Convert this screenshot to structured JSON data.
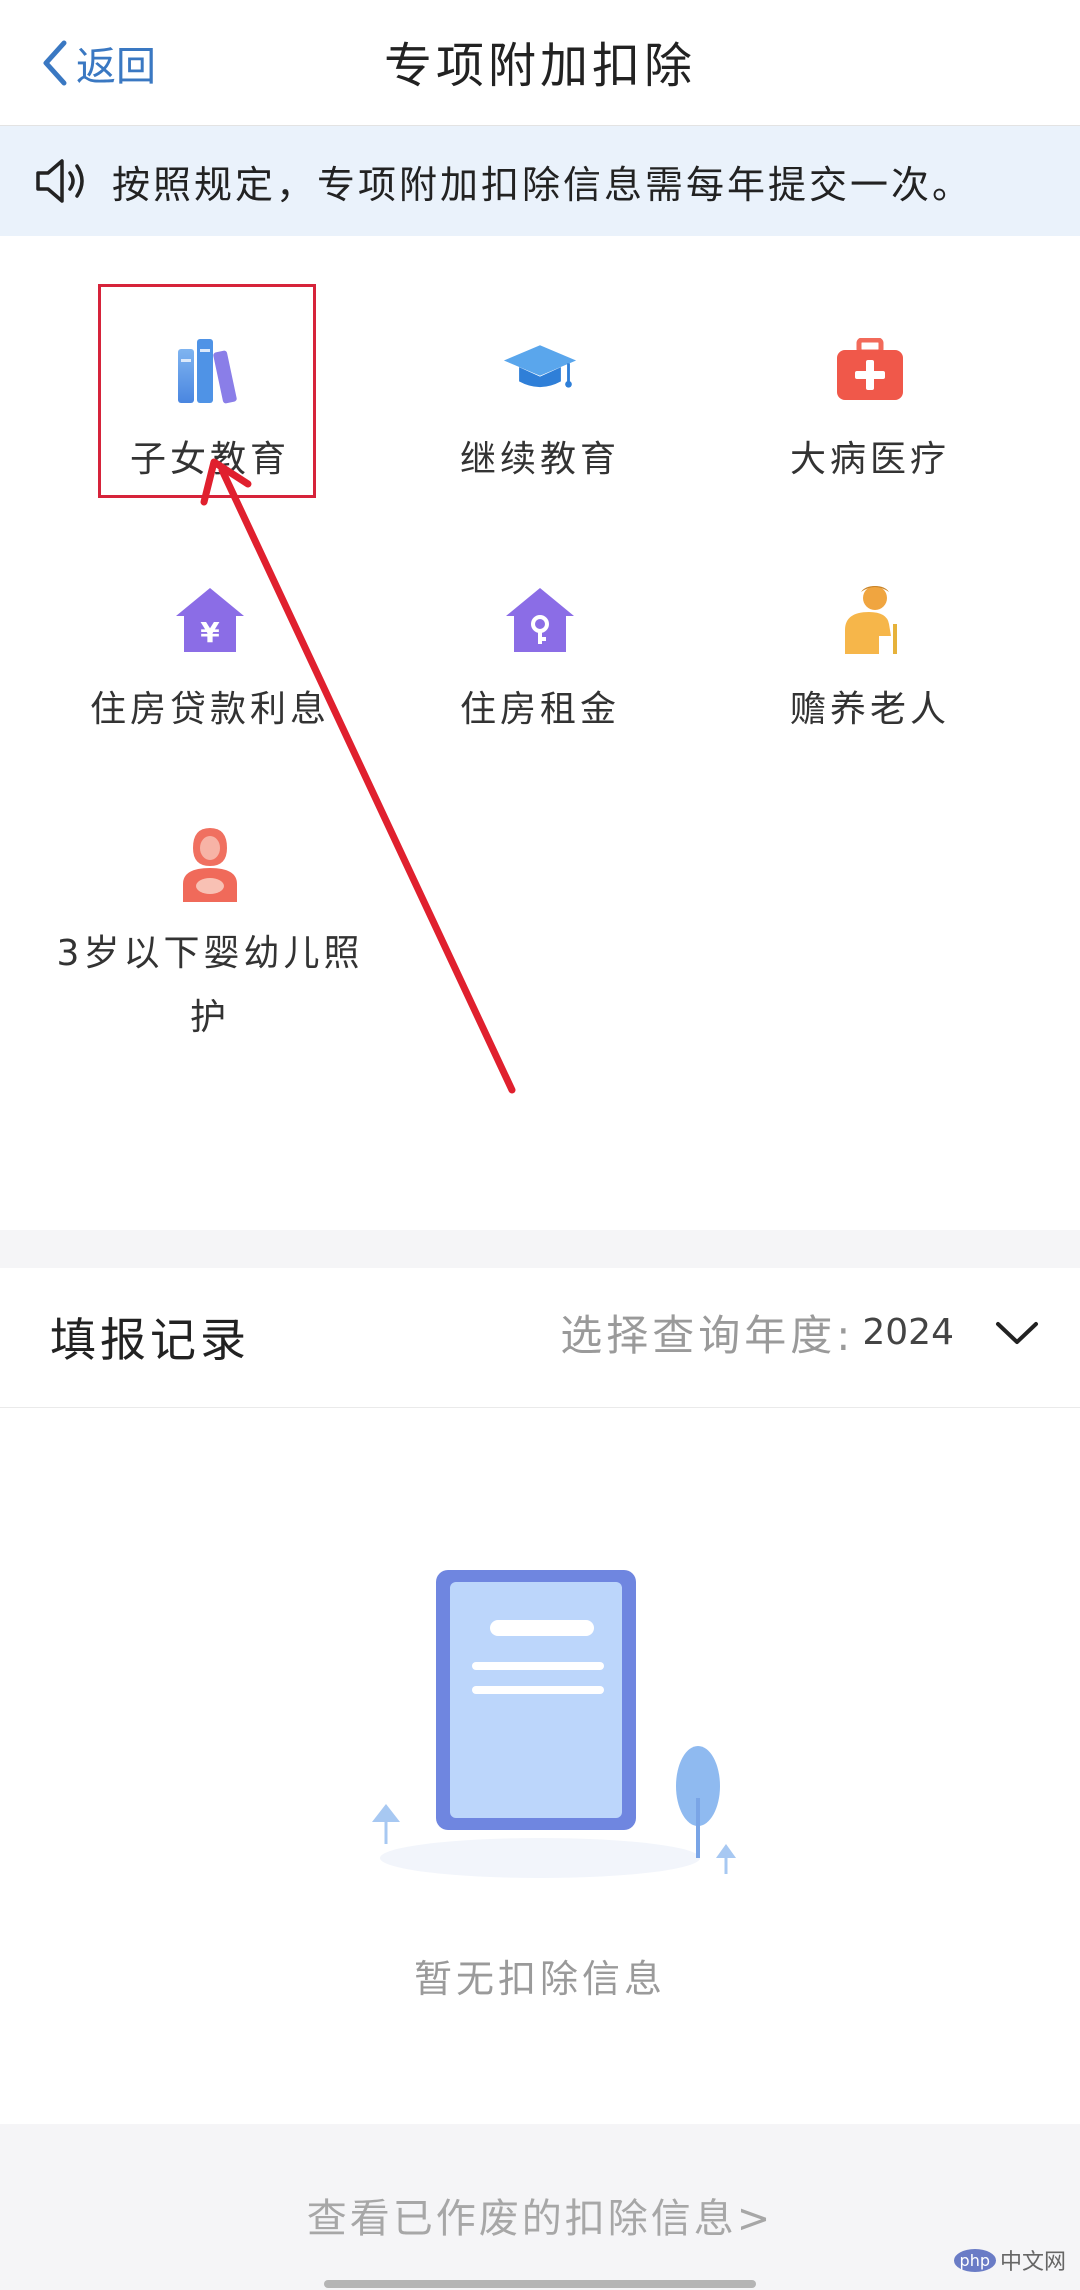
{
  "header": {
    "back_label": "返回",
    "title": "专项附加扣除"
  },
  "notice": {
    "text": "按照规定，专项附加扣除信息需每年提交一次。"
  },
  "categories": [
    {
      "label": "子女教育",
      "icon": "books-icon"
    },
    {
      "label": "继续教育",
      "icon": "graduation-cap-icon"
    },
    {
      "label": "大病医疗",
      "icon": "medical-kit-icon"
    },
    {
      "label": "住房贷款利息",
      "icon": "house-yen-icon"
    },
    {
      "label": "住房租金",
      "icon": "house-key-icon"
    },
    {
      "label": "赡养老人",
      "icon": "elderly-person-icon"
    },
    {
      "label": "3岁以下婴幼儿照护",
      "icon": "mother-baby-icon"
    }
  ],
  "records": {
    "title": "填报记录",
    "year_label": "选择查询年度:",
    "year_value": "2024",
    "empty_text": "暂无扣除信息"
  },
  "footer": {
    "link_text": "查看已作废的扣除信息>"
  },
  "watermark": {
    "badge": "php",
    "text": "中文网"
  },
  "colors": {
    "accent": "#3a78c2",
    "highlight": "#d6233a",
    "notice_bg": "#eaf2fb"
  }
}
